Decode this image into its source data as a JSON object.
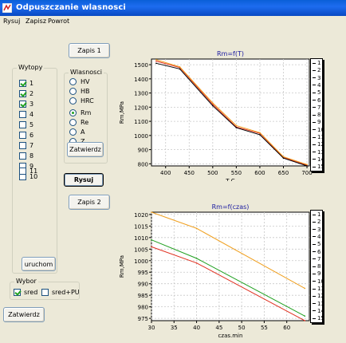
{
  "window": {
    "title": "Odpuszczanie wlasnosci"
  },
  "menu": {
    "items": [
      "Rysuj",
      "Zapisz",
      "Powrot"
    ]
  },
  "buttons": {
    "zapis1": "Zapis 1",
    "zapis2": "Zapis 2",
    "rysuj": "Rysuj",
    "zatwierdz_wlasnosci": "Zatwierdz",
    "uruchom": "uruchom",
    "zatwierdz_main": "Zatwierdz"
  },
  "wytopy": {
    "title": "Wytopy",
    "items": [
      {
        "label": "1",
        "checked": true
      },
      {
        "label": "2",
        "checked": true
      },
      {
        "label": "3",
        "checked": true
      },
      {
        "label": "4",
        "checked": false
      },
      {
        "label": "5",
        "checked": false
      },
      {
        "label": "6",
        "checked": false
      },
      {
        "label": "7",
        "checked": false
      },
      {
        "label": "8",
        "checked": false
      },
      {
        "label": "9",
        "checked": false
      },
      {
        "label": "10",
        "checked": false
      },
      {
        "label": "11",
        "checked": false
      }
    ]
  },
  "wlasnosci": {
    "title": "Wlasnosci",
    "options": [
      {
        "label": "HV",
        "selected": false
      },
      {
        "label": "HB",
        "selected": false
      },
      {
        "label": "HRC",
        "selected": false
      },
      {
        "label": "Rm",
        "selected": true
      },
      {
        "label": "Re",
        "selected": false
      },
      {
        "label": "A",
        "selected": false
      },
      {
        "label": "Z",
        "selected": false
      }
    ]
  },
  "wybor": {
    "title": "Wybor",
    "items": [
      {
        "label": "sred",
        "checked": true
      },
      {
        "label": "sred+PU",
        "checked": false
      }
    ]
  },
  "colors": {
    "series_black": "#000000",
    "series_red": "#e03020",
    "series_orange": "#f0a020",
    "series_green": "#20a020",
    "title_blue": "#1a1aa0"
  },
  "legend": {
    "entries": [
      "1",
      "2",
      "3",
      "4",
      "5",
      "6",
      "7",
      "8",
      "9",
      "10",
      "11",
      "12",
      "13",
      "14",
      "15"
    ]
  },
  "chart_data": [
    {
      "type": "line",
      "title": "Rm=f(T)",
      "xlabel": "T,C",
      "ylabel": "Rm,MPa",
      "xlim": [
        370,
        705
      ],
      "ylim": [
        785,
        1540
      ],
      "xticks": [
        400,
        450,
        500,
        550,
        600,
        650,
        700
      ],
      "yticks": [
        800,
        900,
        1000,
        1100,
        1200,
        1300,
        1400,
        1500
      ],
      "grid": true,
      "x": [
        380,
        430,
        500,
        550,
        600,
        650,
        700
      ],
      "series": [
        {
          "color": "#e03020",
          "values": [
            1525,
            1480,
            1220,
            1060,
            1015,
            845,
            790
          ]
        },
        {
          "color": "#f0a020",
          "values": [
            1535,
            1485,
            1230,
            1070,
            1020,
            850,
            795
          ]
        },
        {
          "color": "#000000",
          "values": [
            1510,
            1470,
            1210,
            1055,
            1005,
            840,
            785
          ]
        }
      ]
    },
    {
      "type": "line",
      "title": "Rm=f(czas)",
      "xlabel": "czas,min",
      "ylabel": "Rm,MPa",
      "xlim": [
        30,
        65
      ],
      "ylim": [
        974,
        1021
      ],
      "xticks": [
        30,
        35,
        40,
        45,
        50,
        55,
        60
      ],
      "yticks": [
        975,
        980,
        985,
        990,
        995,
        1000,
        1005,
        1010,
        1015,
        1020
      ],
      "grid": true,
      "x": [
        30,
        40,
        64
      ],
      "series": [
        {
          "color": "#f0a020",
          "values": [
            1021,
            1014,
            988
          ]
        },
        {
          "color": "#20a020",
          "values": [
            1009,
            1001,
            976
          ]
        },
        {
          "color": "#e03020",
          "values": [
            1006,
            999,
            974
          ]
        }
      ]
    }
  ]
}
